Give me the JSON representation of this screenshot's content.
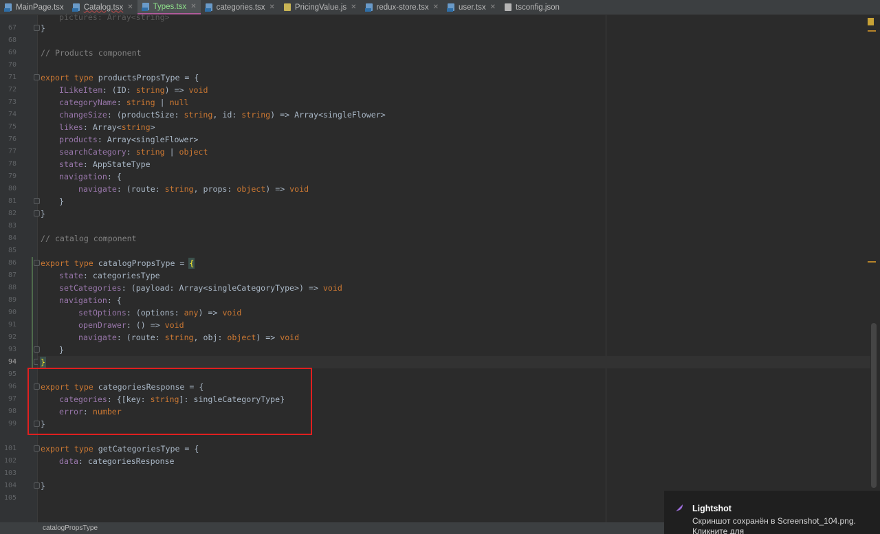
{
  "tabs": [
    {
      "label": "MainPage.tsx",
      "icon": "tsx-file-icon",
      "active": false
    },
    {
      "label": "Catalog.tsx",
      "icon": "tsx-file-icon",
      "active": false
    },
    {
      "label": "Types.tsx",
      "icon": "tsx-file-icon",
      "active": true
    },
    {
      "label": "categories.tsx",
      "icon": "tsx-file-icon",
      "active": false
    },
    {
      "label": "PricingValue.js",
      "icon": "js-file-icon",
      "active": false
    },
    {
      "label": "redux-store.tsx",
      "icon": "tsx-file-icon",
      "active": false
    },
    {
      "label": "user.tsx",
      "icon": "tsx-file-icon",
      "active": false
    },
    {
      "label": "tsconfig.json",
      "icon": "json-file-icon",
      "active": false
    }
  ],
  "line_numbers": [
    "67",
    "68",
    "69",
    "70",
    "71",
    "72",
    "73",
    "74",
    "75",
    "76",
    "77",
    "78",
    "79",
    "80",
    "81",
    "82",
    "83",
    "84",
    "85",
    "86",
    "87",
    "88",
    "89",
    "90",
    "91",
    "92",
    "93",
    "94",
    "95",
    "96",
    "97",
    "98",
    "99",
    "101",
    "102",
    "103",
    "104",
    "105"
  ],
  "current_line": "94",
  "partial_top_line": "pictures: Array<string>",
  "code": {
    "l67": "}",
    "l69": "// Products component",
    "l71_kw": "export type ",
    "l71_name": "productsPropsType",
    "l71_rest": " = {",
    "l72": "ILikeItem",
    "l72b": ": (ID: ",
    "l72c": "string",
    "l72d": ") => ",
    "l72e": "void",
    "l73": "categoryName",
    "l73b": ": ",
    "l73c": "string",
    "l73d": " | ",
    "l73e": "null",
    "l74": "changeSize",
    "l74b": ": (productSize: ",
    "l74c": "string",
    "l74d": ", id: ",
    "l74e": "string",
    "l74f": ") => Array<singleFlower>",
    "l75": "likes",
    "l75b": ": Array<",
    "l75c": "string",
    "l75d": ">",
    "l76": "products",
    "l76b": ": Array<singleFlower>",
    "l77": "searchCategory",
    "l77b": ": ",
    "l77c": "string",
    "l77d": " | ",
    "l77e": "object",
    "l78": "state",
    "l78b": ": AppStateType",
    "l79": "navigation",
    "l79b": ": {",
    "l80": "navigate",
    "l80b": ": (route: ",
    "l80c": "string",
    "l80d": ", props: ",
    "l80e": "object",
    "l80f": ") => ",
    "l80g": "void",
    "l81": "}",
    "l82": "}",
    "l84": "// catalog component",
    "l86_kw": "export type ",
    "l86_name": "catalogPropsType",
    "l86_rest": " = ",
    "l86_brace": "{",
    "l87": "state",
    "l87b": ": categoriesType",
    "l88": "setCategories",
    "l88b": ": (payload: Array<singleCategoryType>) => ",
    "l88c": "void",
    "l89": "navigation",
    "l89b": ": {",
    "l90": "setOptions",
    "l90b": ": (options: ",
    "l90c": "any",
    "l90d": ") => ",
    "l90e": "void",
    "l91": "openDrawer",
    "l91b": ": () => ",
    "l91c": "void",
    "l92": "navigate",
    "l92b": ": (route: ",
    "l92c": "string",
    "l92d": ", obj: ",
    "l92e": "object",
    "l92f": ") => ",
    "l92g": "void",
    "l93": "}",
    "l94": "}",
    "l96_kw": "export type ",
    "l96_name": "categoriesResponse",
    "l96_rest": " = {",
    "l97": "categories",
    "l97b": ": {[key: ",
    "l97c": "string",
    "l97d": "]: singleCategoryType}",
    "l98": "error",
    "l98b": ": ",
    "l98c": "number",
    "l99": "}",
    "l101_kw": "export type ",
    "l101_name": "getCategoriesType",
    "l101_rest": " = {",
    "l102": "data",
    "l102b": ": categoriesResponse",
    "l104": "}"
  },
  "status_bar": {
    "breadcrumb": "catalogPropsType"
  },
  "notification": {
    "title": "Lightshot",
    "message": "Скриншот сохранён в Screenshot_104.png. Кликните для",
    "icon": "feather-icon"
  },
  "colors": {
    "highlight_box": "#e01f1f",
    "active_tab_text": "#8ee08a",
    "keyword": "#cc7832",
    "property": "#9876aa"
  }
}
